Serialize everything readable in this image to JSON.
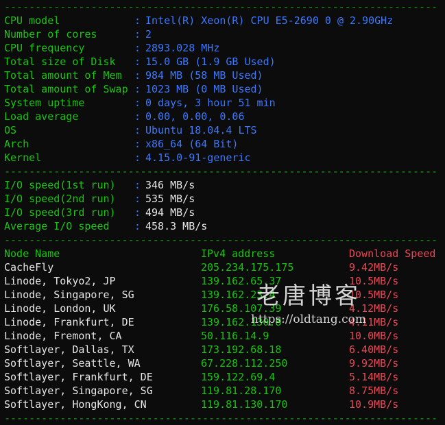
{
  "separator": "----------------------------------------------------------------------",
  "system": [
    {
      "key": "CPU model",
      "value": "Intel(R) Xeon(R) CPU E5-2690 0 @ 2.90GHz"
    },
    {
      "key": "Number of cores",
      "value": "2"
    },
    {
      "key": "CPU frequency",
      "value": "2893.028 MHz"
    },
    {
      "key": "Total size of Disk",
      "value": "15.0 GB (1.9 GB Used)"
    },
    {
      "key": "Total amount of Mem",
      "value": "984 MB (58 MB Used)"
    },
    {
      "key": "Total amount of Swap",
      "value": "1023 MB (0 MB Used)"
    },
    {
      "key": "System uptime",
      "value": "0 days, 3 hour 51 min"
    },
    {
      "key": "Load average",
      "value": "0.00, 0.00, 0.06"
    },
    {
      "key": "OS",
      "value": "Ubuntu 18.04.4 LTS"
    },
    {
      "key": "Arch",
      "value": "x86_64 (64 Bit)"
    },
    {
      "key": "Kernel",
      "value": "4.15.0-91-generic"
    }
  ],
  "io": [
    {
      "key": "I/O speed(1st run)",
      "value": "346 MB/s"
    },
    {
      "key": "I/O speed(2nd run)",
      "value": "535 MB/s"
    },
    {
      "key": "I/O speed(3rd run)",
      "value": "494 MB/s"
    },
    {
      "key": "Average I/O speed",
      "value": "458.3 MB/s"
    }
  ],
  "speedtest": {
    "headers": {
      "node": "Node Name",
      "ip": "IPv4 address",
      "speed": "Download Speed"
    },
    "rows": [
      {
        "node": "CacheFly",
        "ip": "205.234.175.175",
        "speed": "9.42MB/s"
      },
      {
        "node": "Linode, Tokyo2, JP",
        "ip": "139.162.65.37",
        "speed": "10.5MB/s"
      },
      {
        "node": "Linode, Singapore, SG",
        "ip": "139.162.23.4",
        "speed": "10.5MB/s"
      },
      {
        "node": "Linode, London, UK",
        "ip": "176.58.107.39",
        "speed": "4.12MB/s"
      },
      {
        "node": "Linode, Frankfurt, DE",
        "ip": "139.162.130.8",
        "speed": "4.11MB/s"
      },
      {
        "node": "Linode, Fremont, CA",
        "ip": "50.116.14.9",
        "speed": "10.0MB/s"
      },
      {
        "node": "Softlayer, Dallas, TX",
        "ip": "173.192.68.18",
        "speed": "6.40MB/s"
      },
      {
        "node": "Softlayer, Seattle, WA",
        "ip": "67.228.112.250",
        "speed": "9.92MB/s"
      },
      {
        "node": "Softlayer, Frankfurt, DE",
        "ip": "159.122.69.4",
        "speed": "5.14MB/s"
      },
      {
        "node": "Softlayer, Singapore, SG",
        "ip": "119.81.28.170",
        "speed": "8.75MB/s"
      },
      {
        "node": "Softlayer, HongKong, CN",
        "ip": "119.81.130.170",
        "speed": "10.9MB/s"
      }
    ]
  },
  "watermark": {
    "title": "老唐博客",
    "url": "https://oldtang.com"
  },
  "colors": {
    "key": "#16c60c",
    "value": "#3b78ff",
    "speed": "#e74856",
    "separator": "#13a10e"
  }
}
